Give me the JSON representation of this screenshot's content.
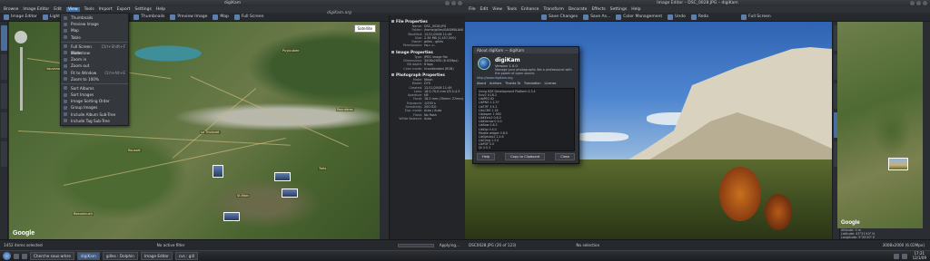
{
  "left_window": {
    "title": "digiKam",
    "menus": [
      "Browse",
      "Image Editor",
      "Edit",
      "View",
      "Tools",
      "Import",
      "Export",
      "Settings",
      "Help"
    ],
    "open_menu": "View",
    "toolbar": [
      "Image Editor",
      "Light Table",
      "Thumbnails",
      "Preview Image",
      "Map",
      "Full Screen"
    ],
    "view_menu": [
      {
        "label": "Thumbnails",
        "shortcut": ""
      },
      {
        "label": "Preview Image",
        "shortcut": ""
      },
      {
        "label": "Map",
        "shortcut": ""
      },
      {
        "label": "Table",
        "shortcut": ""
      },
      {
        "sep": true
      },
      {
        "label": "Full Screen Mode",
        "shortcut": "Ctrl+Shift+F"
      },
      {
        "label": "Slideshow",
        "shortcut": ""
      },
      {
        "label": "Zoom in",
        "shortcut": ""
      },
      {
        "label": "Zoom out",
        "shortcut": ""
      },
      {
        "label": "Fit to Window",
        "shortcut": "Ctrl+Alt+E"
      },
      {
        "label": "Zoom to 100%",
        "shortcut": ""
      },
      {
        "sep": true
      },
      {
        "label": "Sort Albums",
        "shortcut": ""
      },
      {
        "label": "Sort Images",
        "shortcut": ""
      },
      {
        "label": "Image Sorting Order",
        "shortcut": ""
      },
      {
        "label": "Group Images",
        "shortcut": ""
      },
      {
        "label": "Include Album Sub-Tree",
        "shortcut": ""
      },
      {
        "label": "Include Tag Sub-Tree",
        "shortcut": ""
      }
    ],
    "brand": "digiKam.org",
    "map_button": "Satellite",
    "map_labels": [
      "Vauvenargues",
      "Puyloubier",
      "Rousset",
      "Trets",
      "Beaurecueil",
      "Le Tholonet",
      "St-Marc",
      "Pourrières"
    ],
    "google": "Google",
    "props": {
      "file_title": "File Properties",
      "file_rows": [
        [
          "Name:",
          "DSC_0028.JPG"
        ],
        [
          "Folder:",
          "/home/gilles/SAISMBLANC"
        ],
        [
          "Modified:",
          "12/11/2008 11:49"
        ],
        [
          "Size:",
          "2.34 MB (2,457,000)"
        ],
        [
          "Owner:",
          "gilles - gilles"
        ],
        [
          "Permissions:",
          "rw-r--r--"
        ]
      ],
      "image_title": "Image Properties",
      "image_rows": [
        [
          "Type:",
          "JPEG image file"
        ],
        [
          "Dimensions:",
          "3008x2000 (6.02Mpx)"
        ],
        [
          "Bit depth:",
          "8 bpp"
        ],
        [
          "Color mode:",
          "Uncalibrated (RGB)"
        ]
      ],
      "photo_title": "Photograph Properties",
      "photo_rows": [
        [
          "Make:",
          "Nikon"
        ],
        [
          "Model:",
          "D70"
        ],
        [
          "Created:",
          "12/11/2008 11:49"
        ],
        [
          "Lens:",
          "18.0-70.0 mm f/3.5-4.5"
        ],
        [
          "Aperture:",
          "f/8"
        ],
        [
          "Focal:",
          "18.0 mm (35mm: 27mm)"
        ],
        [
          "Exposure:",
          "1/250 s"
        ],
        [
          "Sensitivity:",
          "200 ISO"
        ],
        [
          "Exp. mode:",
          "Auto / Auto"
        ],
        [
          "Flash:",
          "No flash"
        ],
        [
          "White Balance:",
          "Auto"
        ]
      ]
    },
    "status": [
      "1452 items selected",
      "No active filter",
      "Applying..."
    ]
  },
  "right_window": {
    "title": "Image Editor – DSC_0028.JPG – digiKam",
    "menus": [
      "File",
      "Edit",
      "View",
      "Tools",
      "Enhance",
      "Transform",
      "Decorate",
      "Effects",
      "Settings",
      "Help"
    ],
    "toolbar": [
      "Save Changes",
      "Save As...",
      "Color Management",
      "Undo",
      "Redo",
      "Full Screen"
    ],
    "about": {
      "title": "About digiKam — digiKam",
      "name": "digiKam",
      "version": "Version 1.0.0",
      "desc": "Manage your photographs like a professional with the power of open source.",
      "link": "http://www.digikam.org",
      "tabs": [
        "About",
        "Authors",
        "Thanks To",
        "Translation",
        "License"
      ],
      "list": [
        "Using KDE Development Platform 4.3.4",
        "Exiv2 0.18.2",
        "LibJPEG 62",
        "LibPNG 1.2.37",
        "LibTIFF 3.9.2",
        "LibLCMS 1.18",
        "LibJasper 1.900",
        "LibKExiv2 0.6.0",
        "LibKdcraw 0.5.0",
        "LibRaw 0.8.3",
        "LibKipi 0.4.0",
        "Marble widget 0.8.0",
        "LibGphoto2 2.4.6",
        "LibCImg 1.3.0",
        "LibPGF 5.0",
        "Qt 4.5.3",
        "LibClapack",
        "Parallelized demosaicing",
        "LibLqr 0.4.1"
      ],
      "selected_index": 16,
      "btn_left": "Help",
      "btn_mid": "Copy to Clipboard",
      "btn_right": "Close"
    },
    "geo": [
      "Altitude: 0 m",
      "Latitude: 43°31'40\" N",
      "Longitude: 5°35'20\" E"
    ],
    "status": [
      "DSC0028.JPG (26 of 123)",
      "No selection",
      "3008x2000 (6.02Mpx)"
    ]
  },
  "taskbar": {
    "tasks": [
      "Cherche sous-arbre",
      "digiKam",
      "gilles : Dolphin",
      "Image Editor",
      "cvs : gill"
    ],
    "active_index": 1,
    "clock_time": "17:21",
    "clock_date": "12/1/09"
  }
}
